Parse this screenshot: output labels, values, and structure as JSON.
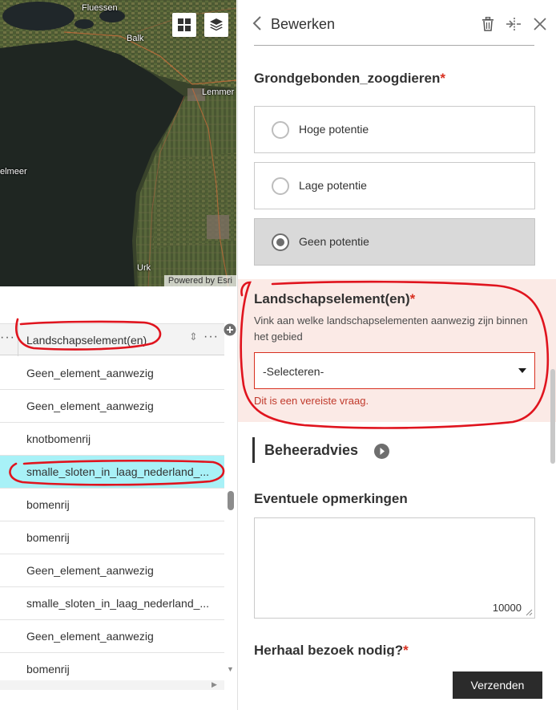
{
  "map": {
    "labels": [
      "Fluessen",
      "Balk",
      "Lemmer",
      "elmeer",
      "Urk"
    ],
    "attribution": "Powered by Esri",
    "buttons": {
      "basemap_gallery": "grid-icon",
      "layer_list": "layers-icon"
    }
  },
  "table": {
    "column_header": "Landschapselement(en)",
    "rows": [
      "Geen_element_aanwezig",
      "Geen_element_aanwezig",
      "knotbomenrij",
      "smalle_sloten_in_laag_nederland_...",
      "bomenrij",
      "bomenrij",
      "Geen_element_aanwezig",
      "smalle_sloten_in_laag_nederland_...",
      "Geen_element_aanwezig",
      "bomenrij"
    ],
    "selected_row": 3
  },
  "panel": {
    "title": "Bewerken",
    "question1": {
      "label": "Grondgebonden_zoogdieren",
      "required_mark": "*",
      "options": [
        "Hoge potentie",
        "Lage potentie",
        "Geen potentie"
      ],
      "selected": 2
    },
    "question2": {
      "label": "Landschapselement(en)",
      "required_mark": "*",
      "description": "Vink aan welke landschapselementen aanwezig zijn binnen het gebied",
      "select_value": "-Selecteren-",
      "error": "Dit is een vereiste vraag."
    },
    "group": {
      "title": "Beheeradvies"
    },
    "question3": {
      "label": "Eventuele opmerkingen",
      "char_count": "10000"
    },
    "question4": {
      "label": "Herhaal bezoek nodig?",
      "required_mark": "*"
    },
    "submit_label": "Verzenden"
  },
  "colors": {
    "required": "#d83020",
    "selected_row": "#a8f1f7",
    "error_bg": "#fbeae6",
    "annotation": "#e0141e"
  }
}
